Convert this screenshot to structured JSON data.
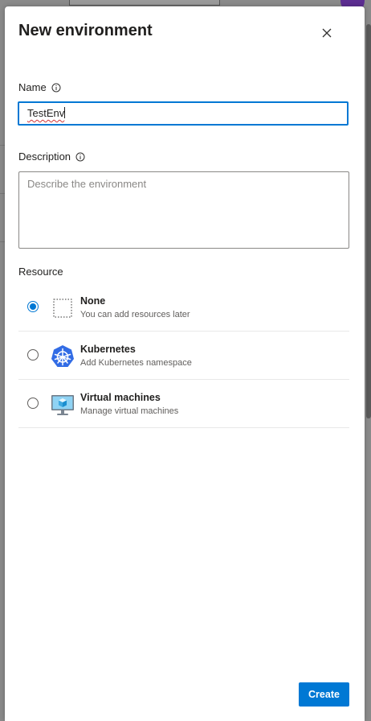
{
  "dialog": {
    "title": "New environment",
    "name_label": "Name",
    "name_value": "TestEnv",
    "description_label": "Description",
    "description_placeholder": "Describe the environment",
    "resource_label": "Resource",
    "resources": [
      {
        "title": "None",
        "subtitle": "You can add resources later",
        "icon": "dotted-box-icon",
        "selected": true
      },
      {
        "title": "Kubernetes",
        "subtitle": "Add Kubernetes namespace",
        "icon": "kubernetes-icon",
        "selected": false
      },
      {
        "title": "Virtual machines",
        "subtitle": "Manage virtual machines",
        "icon": "virtual-machine-icon",
        "selected": false
      }
    ],
    "create_label": "Create"
  },
  "colors": {
    "accent": "#0078d4",
    "overlay": "#8a8a8a",
    "kubernetes": "#326ce5"
  }
}
